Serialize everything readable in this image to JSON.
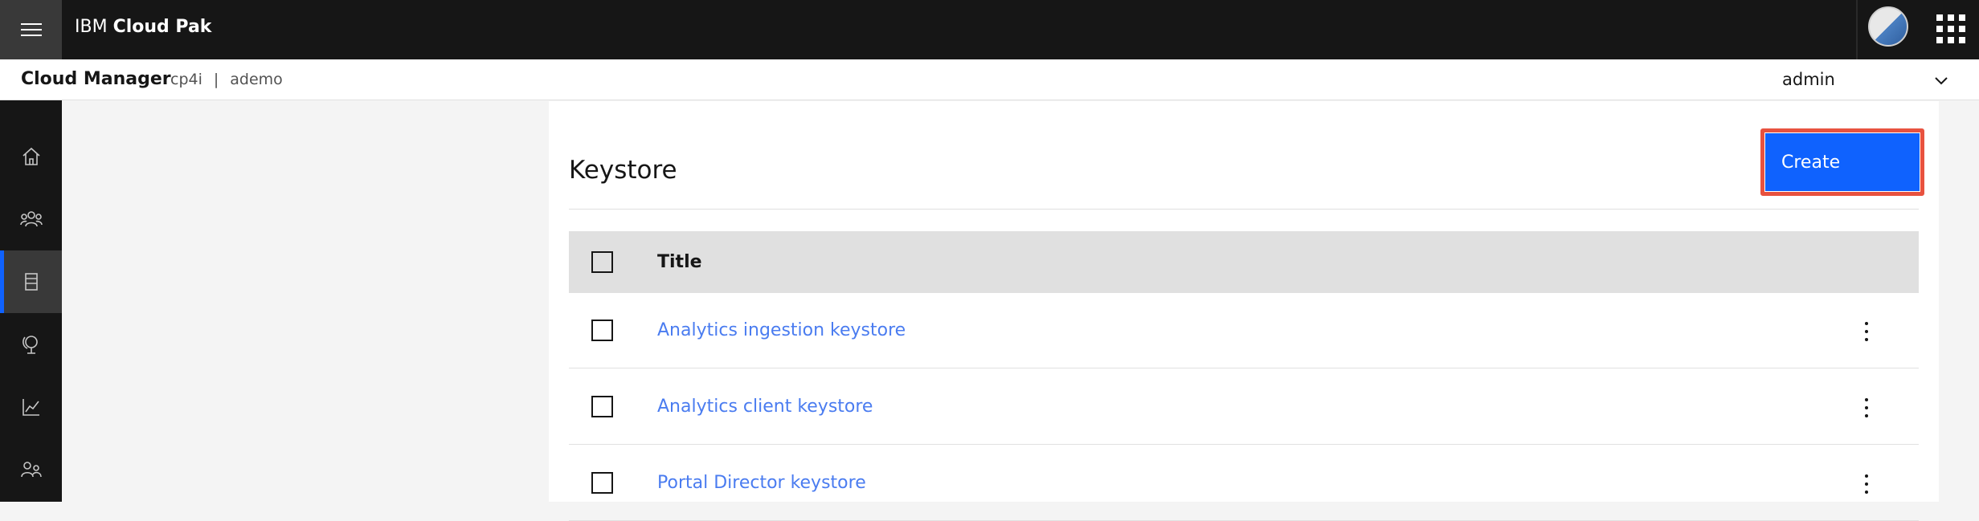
{
  "header": {
    "brand_prefix": "IBM",
    "brand_name": "Cloud Pak",
    "menu_icon": "hamburger-menu-icon",
    "avatar_icon": "user-avatar",
    "apps_icon": "app-switcher-icon"
  },
  "subheader": {
    "title": "Cloud Manager",
    "breadcrumb": [
      "cp4i",
      "ademo"
    ],
    "separator": "|",
    "user": "admin"
  },
  "leftnav": {
    "items": [
      {
        "icon": "home-icon"
      },
      {
        "icon": "users-icon"
      },
      {
        "icon": "resources-icon",
        "active": true
      },
      {
        "icon": "topology-icon"
      },
      {
        "icon": "analytics-icon"
      },
      {
        "icon": "members-icon"
      }
    ]
  },
  "panel": {
    "title": "Keystore",
    "create_label": "Create",
    "table": {
      "header_title": "Title",
      "rows": [
        {
          "title": "Analytics ingestion keystore"
        },
        {
          "title": "Analytics client keystore"
        },
        {
          "title": "Portal Director keystore"
        }
      ]
    }
  },
  "colors": {
    "accent": "#0f62fe",
    "link": "#4a7cf0",
    "header_bg": "#161616",
    "highlight": "#e8523f"
  }
}
